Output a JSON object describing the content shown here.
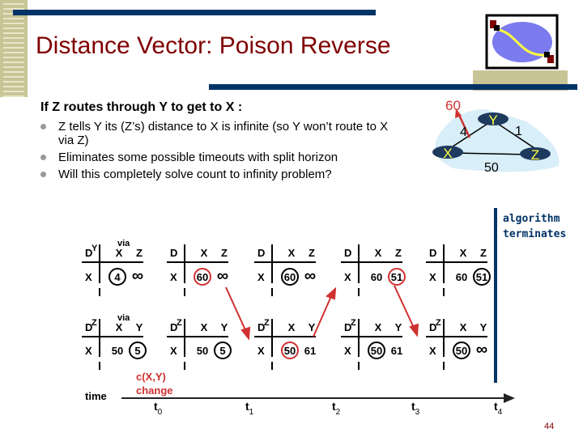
{
  "title": "Distance Vector: Poison Reverse",
  "subhead": "If Z routes through Y to get to X :",
  "bullets": [
    "Z tells Y its (Z’s) distance to X is infinite (so Y won’t route to X via Z)",
    "Eliminates some possible timeouts with split horizon",
    "Will this completely solve count to infinity problem?"
  ],
  "network": {
    "nodes": [
      "X",
      "Y",
      "Z"
    ],
    "links": {
      "xy": "4",
      "yz": "1",
      "xz": "50"
    },
    "changed_cost": "60"
  },
  "terminates": [
    "algorithm",
    "terminates"
  ],
  "page_number": "44",
  "colors": {
    "title": "#800000",
    "bar": "#003366",
    "tan": "#c8c496",
    "red": "#d03030"
  },
  "tables": {
    "top": [
      {
        "super": "Y",
        "via": "via",
        "cols": [
          "X",
          "Z"
        ],
        "row": "X",
        "vals": [
          {
            "v": "4",
            "c": "black"
          },
          {
            "v": "∞",
            "c": "none"
          }
        ]
      },
      {
        "super": "",
        "via": "",
        "cols": [
          "X",
          "Z"
        ],
        "row": "X",
        "vals": [
          {
            "v": "60",
            "c": "red"
          },
          {
            "v": "∞",
            "c": "none"
          }
        ]
      },
      {
        "super": "",
        "via": "",
        "cols": [
          "X",
          "Z"
        ],
        "row": "X",
        "vals": [
          {
            "v": "60",
            "c": "black"
          },
          {
            "v": "∞",
            "c": "none"
          }
        ]
      },
      {
        "super": "",
        "via": "",
        "cols": [
          "X",
          "Z"
        ],
        "row": "X",
        "vals": [
          {
            "v": "60",
            "c": "none"
          },
          {
            "v": "51",
            "c": "red"
          }
        ]
      },
      {
        "super": "",
        "via": "",
        "cols": [
          "X",
          "Z"
        ],
        "row": "X",
        "vals": [
          {
            "v": "60",
            "c": "none"
          },
          {
            "v": "51",
            "c": "black"
          }
        ]
      }
    ],
    "bottom": [
      {
        "super": "Z",
        "via": "via",
        "cols": [
          "X",
          "Y"
        ],
        "row": "X",
        "vals": [
          {
            "v": "50",
            "c": "none"
          },
          {
            "v": "5",
            "c": "black"
          }
        ]
      },
      {
        "super": "Z",
        "via": "",
        "cols": [
          "X",
          "Y"
        ],
        "row": "X",
        "vals": [
          {
            "v": "50",
            "c": "none"
          },
          {
            "v": "5",
            "c": "black"
          }
        ]
      },
      {
        "super": "Z",
        "via": "",
        "cols": [
          "X",
          "Y"
        ],
        "row": "X",
        "vals": [
          {
            "v": "50",
            "c": "red"
          },
          {
            "v": "61",
            "c": "none"
          }
        ]
      },
      {
        "super": "Z",
        "via": "",
        "cols": [
          "X",
          "Y"
        ],
        "row": "X",
        "vals": [
          {
            "v": "50",
            "c": "black"
          },
          {
            "v": "61",
            "c": "none"
          }
        ]
      },
      {
        "super": "Z",
        "via": "",
        "cols": [
          "X",
          "Y"
        ],
        "row": "X",
        "vals": [
          {
            "v": "50",
            "c": "black"
          },
          {
            "v": "∞",
            "c": "none"
          }
        ]
      }
    ]
  },
  "change_label": [
    "c(X,Y)",
    "change"
  ],
  "time_label": "time",
  "ticks": [
    {
      "t": "t",
      "s": "0"
    },
    {
      "t": "t",
      "s": "1"
    },
    {
      "t": "t",
      "s": "2"
    },
    {
      "t": "t",
      "s": "3"
    },
    {
      "t": "t",
      "s": "4"
    }
  ],
  "logo_icon": "network-cloud-icon"
}
